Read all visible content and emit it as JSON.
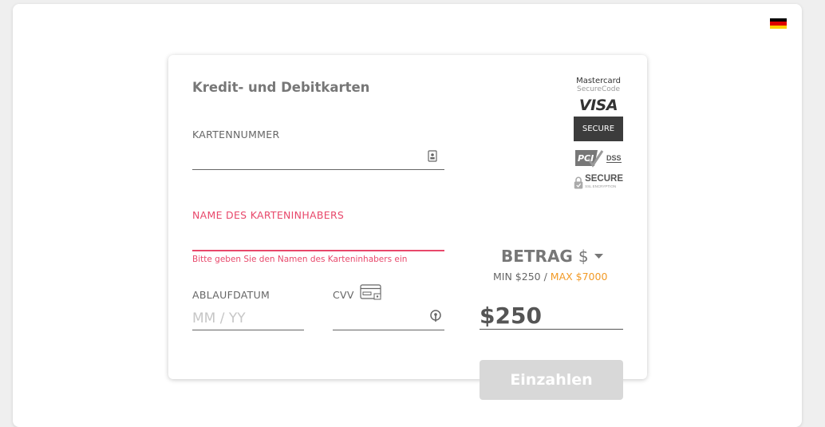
{
  "colors": {
    "accent_error": "#e8486b",
    "max_highlight": "#f29a26",
    "submit_bg": "#d8d8d8"
  },
  "language": {
    "icon": "germany-flag-icon",
    "flag_colors": [
      "#000000",
      "#dd0000",
      "#ffce00"
    ]
  },
  "form": {
    "title": "Kredit- und Debitkarten",
    "card_number": {
      "label": "KARTENNUMMER",
      "value": "",
      "placeholder": "",
      "icon": "card-scan-icon"
    },
    "holder_name": {
      "label": "NAME DES KARTENINHABERS",
      "value": "",
      "placeholder": "",
      "error": "Bitte geben Sie den Namen des Karteninhabers ein"
    },
    "expiry": {
      "label": "ABLAUFDATUM",
      "value": "",
      "placeholder": "MM / YY"
    },
    "cvv": {
      "label": "CVV",
      "value": "",
      "placeholder": "",
      "label_icon": "cvv-card-icon",
      "field_icon": "lock-icon"
    }
  },
  "badges": {
    "mastercard_line1": "Mastercard",
    "mastercard_line2": "SecureCode",
    "visa": "VISA",
    "secure": "SECURE",
    "pci": "PCI",
    "dss": "DSS",
    "ssl_title": "SECURE",
    "ssl_sub": "SSL ENCRYPTION"
  },
  "amount": {
    "label": "BETRAG",
    "currency": "$",
    "min_text": "MIN $250 /",
    "max_text": "MAX $7000",
    "value": "$250"
  },
  "submit_label": "Einzahlen"
}
